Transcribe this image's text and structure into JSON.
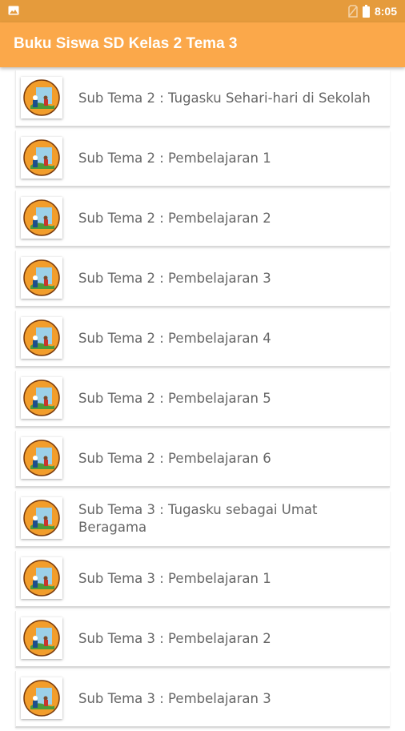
{
  "status_bar": {
    "time": "8:05"
  },
  "app_bar": {
    "title": "Buku Siswa SD Kelas 2 Tema 3"
  },
  "list": {
    "items": [
      {
        "label": "Sub Tema 2 : Tugasku Sehari-hari di Sekolah"
      },
      {
        "label": "Sub Tema 2 : Pembelajaran 1"
      },
      {
        "label": "Sub Tema 2 : Pembelajaran 2"
      },
      {
        "label": "Sub Tema 2 : Pembelajaran 3"
      },
      {
        "label": "Sub Tema 2 : Pembelajaran 4"
      },
      {
        "label": "Sub Tema 2 : Pembelajaran 5"
      },
      {
        "label": "Sub Tema 2 : Pembelajaran 6"
      },
      {
        "label": "Sub Tema 3 : Tugasku sebagai Umat Beragama"
      },
      {
        "label": "Sub Tema 3 : Pembelajaran 1"
      },
      {
        "label": "Sub Tema 3 : Pembelajaran 2"
      },
      {
        "label": "Sub Tema 3 : Pembelajaran 3"
      }
    ]
  },
  "icons": {
    "status_left": "image-icon",
    "status_sim": "no-sim-icon",
    "status_battery": "battery-icon",
    "item_thumbnail": "book-cover-thumbnail-icon"
  },
  "colors": {
    "status_bar": "#e59b3c",
    "app_bar": "#fba84a",
    "text": "#666666"
  }
}
